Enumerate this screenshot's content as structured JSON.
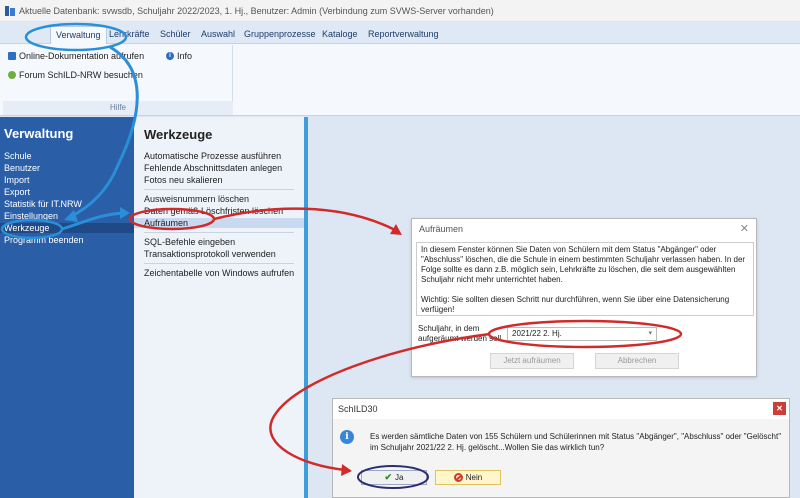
{
  "window": {
    "title": "Aktuelle Datenbank: svwsdb, Schuljahr 2022/2023, 1. Hj., Benutzer: Admin (Verbindung zum SVWS-Server vorhanden)"
  },
  "ribbon": {
    "tabs": [
      "Verwaltung",
      "Lehrkräfte",
      "Schüler",
      "Auswahl",
      "Gruppenprozesse",
      "Kataloge",
      "Reportverwaltung"
    ],
    "active_tab": "Verwaltung",
    "group": {
      "items": {
        "online_doc": "Online-Dokumentation aufrufen",
        "info": "Info",
        "forum": "Forum SchILD-NRW besuchen"
      },
      "label": "Hilfe"
    }
  },
  "leftnav": {
    "title": "Verwaltung",
    "items": [
      "Schule",
      "Benutzer",
      "Import",
      "Export",
      "Statistik für IT.NRW",
      "Einstellungen",
      "Werkzeuge",
      "Programm beenden"
    ],
    "selected": "Werkzeuge"
  },
  "tools": {
    "title": "Werkzeuge",
    "items": [
      "Automatische Prozesse ausführen",
      "Fehlende Abschnittsdaten anlegen",
      "Fotos neu skalieren",
      "Ausweisnummern löschen",
      "Daten gemäß Löschfristen löschen",
      "Aufräumen",
      "SQL-Befehle eingeben",
      "Transaktionsprotokoll verwenden",
      "Zeichentabelle von Windows aufrufen"
    ],
    "selected": "Aufräumen"
  },
  "cleanup_dialog": {
    "title": "Aufräumen",
    "close": "✕",
    "paragraph1": "In diesem Fenster können Sie Daten von Schülern mit dem Status \"Abgänger\" oder \"Abschluss\" löschen, die die Schule in einem bestimmten Schuljahr verlassen haben. In der Folge sollte es dann z.B. möglich sein, Lehrkräfte zu löschen, die seit dem ausgewählten Schuljahr nicht mehr unterrichtet haben.",
    "paragraph2": "Wichtig: Sie sollten diesen Schritt nur durchführen, wenn Sie über eine Datensicherung verfügen!",
    "field_label": "Schuljahr, in dem aufgeräumt werden soll",
    "selected_value": "2021/22 2. Hj.",
    "btn_cleanup": "Jetzt aufräumen",
    "btn_cancel": "Abbrechen"
  },
  "confirm_dialog": {
    "title": "SchILD30",
    "close": "✕",
    "message": "Es werden sämtliche Daten von 155 Schülern und Schülerinnen mit Status \"Abgänger\", \"Abschluss\" oder \"Gelöscht\" im Schuljahr 2021/22 2. Hj. gelöscht...Wollen Sie das wirklich tun?",
    "btn_yes": "Ja",
    "btn_no": "Nein"
  },
  "colors": {
    "nav_blue": "#2a5fa8",
    "accent_cyan": "#3f9ed9",
    "annotation_blue": "#2a8fd8",
    "annotation_red": "#d12a2a"
  }
}
